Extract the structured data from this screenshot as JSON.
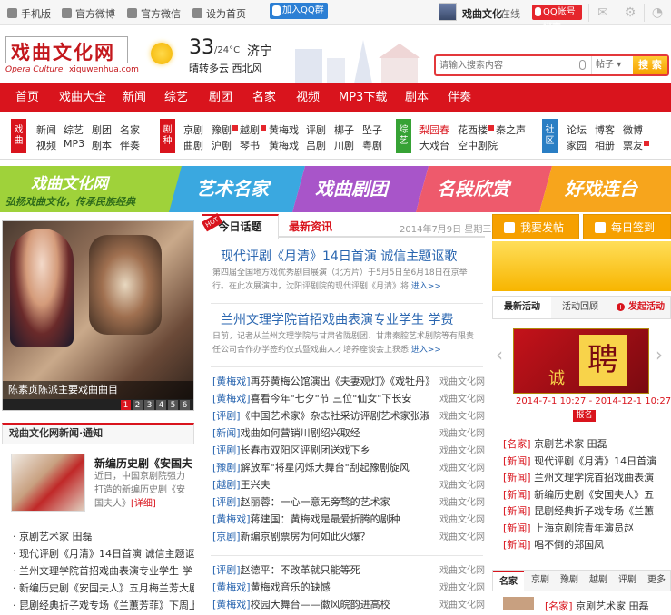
{
  "topbar": {
    "items": [
      "手机版",
      "官方微博",
      "官方微信",
      "设为首页"
    ],
    "qq_group": "加入QQ群",
    "user_name": "戏曲文化",
    "online": "在线",
    "qq_bind": "QQ帐号绑定"
  },
  "logo": {
    "cn": "戏曲文化网",
    "en": "Opera Culture",
    "domain": "xiquwenhua.com"
  },
  "weather": {
    "temp": "33",
    "temp_low": "/24°C",
    "city": "济宁",
    "desc": "晴转多云  西北风"
  },
  "search": {
    "placeholder": "请输入搜索内容",
    "scope": "帖子",
    "button": "搜 索"
  },
  "nav": [
    "首页",
    "戏曲大全",
    "新闻",
    "综艺",
    "剧团",
    "名家",
    "视频",
    "MP3下载",
    "剧本",
    "伴奏"
  ],
  "subnav": {
    "g1": {
      "tag": "戏曲",
      "row1": [
        "新闻",
        "综艺",
        "剧团",
        "名家"
      ],
      "row2": [
        "视频",
        "MP3",
        "剧本",
        "伴奏"
      ]
    },
    "g2": {
      "tag": "剧种",
      "row1": [
        "京剧",
        "豫剧",
        "越剧",
        "黄梅戏",
        "评剧",
        "梆子",
        "坠子"
      ],
      "row2": [
        "曲剧",
        "沪剧",
        "琴书",
        "黄梅戏",
        "吕剧",
        "川剧",
        "粤剧"
      ]
    },
    "g3": {
      "tag": "综艺",
      "row1": [
        "梨园春",
        "花西楼",
        "秦之声"
      ],
      "row2": [
        "大戏台",
        "空中剧院"
      ]
    },
    "g4": {
      "tag": "社区",
      "row1": [
        "论坛",
        "博客",
        "微博"
      ],
      "row2": [
        "家园",
        "相册",
        "票友"
      ]
    }
  },
  "banner": {
    "title": "戏曲文化网",
    "slogan": "弘扬戏曲文化，传承民族经典",
    "items": [
      "艺术名家",
      "戏曲剧团",
      "名段欣赏",
      "好戏连台"
    ]
  },
  "slider": {
    "caption": "陈素贞陈派主要戏曲曲目",
    "pages": [
      "1",
      "2",
      "3",
      "4",
      "5",
      "6"
    ]
  },
  "left_news": {
    "heading": "戏曲文化网新闻·通知",
    "feature_title": "新编历史剧《安国夫",
    "feature_desc": "近日，中国京剧院强力打造的新编历史剧《安国夫人》",
    "feature_more": "[详细]",
    "items": [
      "京剧艺术家 田磊",
      "现代评剧《月清》14日首演 诚信主题讴",
      "兰州文理学院首招戏曲表演专业学生 学",
      "新编历史剧《安国夫人》五月梅兰芳大剧",
      "昆剧经典折子戏专场《兰蕙芳菲》下周上"
    ]
  },
  "mid": {
    "tab_active": "今日话题",
    "tab_other": "最新资讯",
    "hot": "HOT",
    "date": "2014年7月9日  星期三",
    "headline1": "现代评剧《月清》14日首演 诚信主题讴歌",
    "desc1": "第四届全国地方戏优秀剧目展演（北方片）于5月5日至6月18日在京举行。在此次展演中，沈阳评剧院的现代评剧《月清》将",
    "more1": "进入>>",
    "headline2": "兰州文理学院首招戏曲表演专业学生 学费",
    "desc2": "日前，记者从兰州文理学院与甘肃省陇剧团、甘肃秦腔艺术剧院等有限责任公司合作办学签约仪式暨戏曲人才培养座谈会上获悉",
    "more2": "进入>>",
    "source": "戏曲文化网",
    "list1": [
      {
        "cat": "[黄梅戏]",
        "title": "再芬黄梅公馆演出《夫妻观灯》《戏牡丹》"
      },
      {
        "cat": "[黄梅戏]",
        "title": "喜看今年\"七夕\"节 三位\"仙女\"下长安"
      },
      {
        "cat": "[评剧]",
        "title": "《中国艺术家》杂志社采访评剧艺术家张淑"
      },
      {
        "cat": "[新闻]",
        "title": "戏曲如何营销川剧绍兴取经"
      },
      {
        "cat": "[评剧]",
        "title": "长春市双阳区评剧团送戏下乡"
      },
      {
        "cat": "[豫剧]",
        "title": "解放军\"将星闪烁大舞台\"刮起豫剧旋风"
      },
      {
        "cat": "[越剧]",
        "title": "王兴夫"
      },
      {
        "cat": "[评剧]",
        "title": "赵丽蓉：一心一意无旁骛的艺术家"
      },
      {
        "cat": "[黄梅戏]",
        "title": "蒋建国：黄梅戏是最爱折腾的剧种"
      },
      {
        "cat": "[京剧]",
        "title": "新编京剧票房为何如此火爆？"
      }
    ],
    "list2": [
      {
        "cat": "[评剧]",
        "title": "赵德平：不改革就只能等死"
      },
      {
        "cat": "[黄梅戏]",
        "title": "黄梅戏音乐的缺憾"
      },
      {
        "cat": "[黄梅戏]",
        "title": "校园大舞台——徽风皖韵进高校"
      }
    ]
  },
  "right": {
    "post": "我要发帖",
    "sign": "每日签到",
    "tabs": [
      "最新活动",
      "活动回顾",
      "发起活动"
    ],
    "act_big": "聘",
    "act_small": "诚",
    "act_date": "2014-7-1 10:27 - 2014-12-1 10:27",
    "act_btn": "报名",
    "list": [
      {
        "cat": "[名家]",
        "title": "京剧艺术家 田磊"
      },
      {
        "cat": "[新闻]",
        "title": "现代评剧《月清》14日首演"
      },
      {
        "cat": "[新闻]",
        "title": "兰州文理学院首招戏曲表演"
      },
      {
        "cat": "[新闻]",
        "title": "新编历史剧《安国夫人》五"
      },
      {
        "cat": "[新闻]",
        "title": "昆剧经典折子戏专场《兰蕙"
      },
      {
        "cat": "[新闻]",
        "title": "上海京剧院青年演员赵"
      },
      {
        "cat": "[新闻]",
        "title": "唱不倒的郑国凤"
      }
    ],
    "tabs2": [
      "名家",
      "京剧",
      "豫剧",
      "越剧",
      "评剧",
      "更多"
    ],
    "last": {
      "cat": "[名家]",
      "title": "京剧艺术家 田磊"
    }
  },
  "colors": {
    "brand_red": "#d9141d",
    "accent_orange": "#f6a000",
    "link_blue": "#2a66b0"
  }
}
